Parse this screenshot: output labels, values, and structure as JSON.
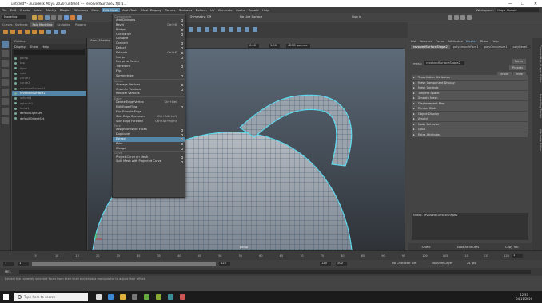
{
  "window": {
    "title": "untitled* - Autodesk Maya 2020: untitled   ---   revolvedSurface2.f[0:1...",
    "controls": [
      "—",
      "❐",
      "✕"
    ]
  },
  "menubar": {
    "items": [
      "File",
      "Edit",
      "Create",
      "Select",
      "Modify",
      "Display",
      "Windows",
      "Mesh",
      "Edit Mesh",
      "Mesh Tools",
      "Mesh Display",
      "Curves",
      "Surfaces",
      "Deform",
      "UV",
      "Generate",
      "Cache",
      "Arnold",
      "Help"
    ],
    "active": "Edit Mesh",
    "workspace_label": "Workspace:",
    "workspace_value": "Maya Classic"
  },
  "statusline": {
    "mode": "Modeling",
    "symmetry": "Symmetry: Off",
    "live": "No Live Surface",
    "signin": "Sign in"
  },
  "shelf": {
    "tabs": [
      "Curves / Surfaces",
      "Poly Modeling",
      "Sculpting",
      "Rigging"
    ],
    "active": "Poly Modeling"
  },
  "outliner": {
    "title": "Outliner",
    "menu": [
      "Display",
      "Show",
      "Help"
    ],
    "rows": [
      {
        "label": "persp",
        "dim": true
      },
      {
        "label": "top",
        "dim": true
      },
      {
        "label": "front",
        "dim": true
      },
      {
        "label": "side",
        "dim": true
      },
      {
        "label": "curve1",
        "dim": true
      },
      {
        "label": "curve2",
        "dim": true
      },
      {
        "label": "revolvedSurface1",
        "dim": true
      },
      {
        "label": "revolvedSurface2",
        "dim": false,
        "sel": true
      },
      {
        "label": "sphere1",
        "dim": true
      },
      {
        "label": "extrude1",
        "dim": true
      },
      {
        "label": "torus1",
        "dim": true
      },
      {
        "label": "defaultLightSet",
        "dim": false
      },
      {
        "label": "defaultObjectSet",
        "dim": false
      }
    ]
  },
  "viewport": {
    "menu": [
      "View",
      "Shading",
      "Lighting",
      "Show",
      "Renderer",
      "Panels"
    ],
    "field1": "0.00",
    "field2": "1.00",
    "colorspace": "sRGB gamma",
    "camera_label": "persp"
  },
  "editmesh_menu": {
    "sections": [
      {
        "header": "Components",
        "items": [
          {
            "label": "Add Divisions",
            "shortcut": "",
            "box": true
          },
          {
            "label": "Bevel",
            "shortcut": "Ctrl+B",
            "box": true
          },
          {
            "label": "Bridge",
            "shortcut": "",
            "box": true
          },
          {
            "label": "Circularize",
            "shortcut": "",
            "box": true
          },
          {
            "label": "Collapse",
            "shortcut": "",
            "box": false
          },
          {
            "label": "Connect",
            "shortcut": "",
            "box": true
          },
          {
            "label": "Detach",
            "shortcut": "",
            "box": true
          },
          {
            "label": "Extrude",
            "shortcut": "Ctrl+E",
            "box": true
          },
          {
            "label": "Merge",
            "shortcut": "",
            "box": true
          },
          {
            "label": "Merge to Center",
            "shortcut": "",
            "box": false
          },
          {
            "label": "Transform",
            "shortcut": "",
            "box": true
          },
          {
            "label": "Flip",
            "shortcut": "",
            "box": false
          },
          {
            "label": "Symmetrize",
            "shortcut": "",
            "box": true
          }
        ]
      },
      {
        "header": "Vertex",
        "items": [
          {
            "label": "Average Vertices",
            "shortcut": "",
            "box": true
          },
          {
            "label": "Chamfer Vertices",
            "shortcut": "",
            "box": true
          },
          {
            "label": "Reorder Vertices",
            "shortcut": "",
            "box": false
          }
        ]
      },
      {
        "header": "Edge",
        "items": [
          {
            "label": "Delete Edge/Vertex",
            "shortcut": "Ctrl+Del",
            "box": false
          },
          {
            "label": "Edit Edge Flow",
            "shortcut": "",
            "box": true
          },
          {
            "label": "Flip Triangle Edge",
            "shortcut": "",
            "box": false
          },
          {
            "label": "Spin Edge Backward",
            "shortcut": "Ctrl+Alt+Left",
            "box": false
          },
          {
            "label": "Spin Edge Forward",
            "shortcut": "Ctrl+Alt+Right",
            "box": false
          }
        ]
      },
      {
        "header": "Face",
        "items": [
          {
            "label": "Assign Invisible Faces",
            "shortcut": "",
            "box": true
          },
          {
            "label": "Duplicate",
            "shortcut": "",
            "box": true
          },
          {
            "label": "Extract",
            "shortcut": "",
            "box": true,
            "hl": true
          },
          {
            "label": "Poke",
            "shortcut": "",
            "box": true
          },
          {
            "label": "Wedge",
            "shortcut": "",
            "box": true
          }
        ]
      },
      {
        "header": "Curve",
        "items": [
          {
            "label": "Project Curve on Mesh",
            "shortcut": "",
            "box": true
          },
          {
            "label": "Split Mesh with Projected Curve",
            "shortcut": "",
            "box": true
          }
        ]
      }
    ]
  },
  "attribute_editor": {
    "menu": [
      "List",
      "Selected",
      "Focus",
      "Attributes",
      "Display",
      "Show",
      "Help"
    ],
    "tabs": [
      "revolvedSurfaceShape2",
      "polySmoothFace1",
      "polyCircularize1",
      "polyBevel1"
    ],
    "active_tab": "revolvedSurfaceShape2",
    "mesh_label": "mesh:",
    "mesh_value": "revolvedSurfaceShape2",
    "buttons": [
      "Focus",
      "Presets",
      "Show",
      "Hide"
    ],
    "sections": [
      "Tessellation Attributes",
      "Mesh Component Display",
      "Mesh Controls",
      "Tangent Space",
      "Smooth Mesh",
      "Displacement Map",
      "Render Stats",
      "Object Display",
      "Arnold",
      "Node Behavior",
      "UUID",
      "Extra Attributes"
    ],
    "notes": "Notes: revolvedSurfaceShape2",
    "bottom": [
      "Select",
      "Load Attributes",
      "Copy Tab"
    ]
  },
  "sidetabs": [
    "Channel Box / Layer Editor",
    "Modelling Toolkit",
    "Attribute Editor"
  ],
  "time": {
    "ticks": [
      "5",
      "10",
      "15",
      "20",
      "25",
      "30",
      "35",
      "40",
      "45",
      "50",
      "55",
      "60",
      "65",
      "70",
      "75",
      "80",
      "85",
      "90",
      "95",
      "100",
      "105",
      "110",
      "115",
      "120"
    ],
    "start": "1",
    "end": "120",
    "range_end": "120",
    "max": "200",
    "char": "No Character Set",
    "anim": "No Anim Layer",
    "fps": "24 fps",
    "current": "1"
  },
  "mel": {
    "label": "MEL"
  },
  "help": {
    "text": "Extract the currently selected faces from their shell and show a manipulator to adjust their offset."
  },
  "taskbar": {
    "search": "Type here to search",
    "time": "12:57",
    "date": "04/11/2020"
  }
}
